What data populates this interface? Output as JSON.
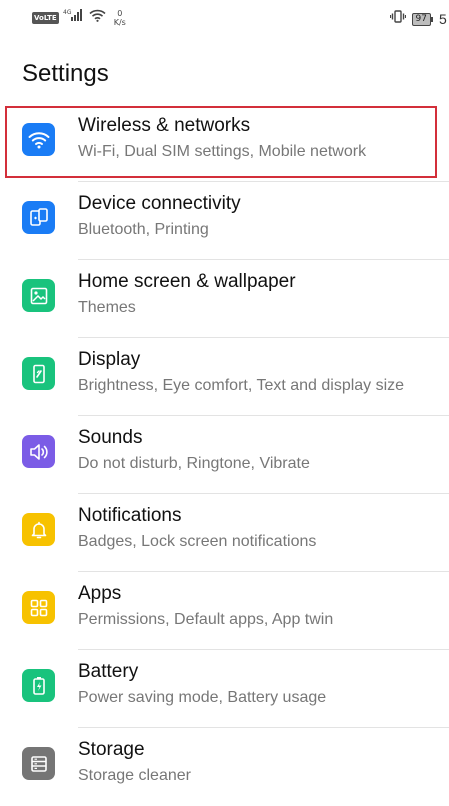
{
  "status_bar": {
    "network_label": "VoLTE",
    "network_type": "4G",
    "speed_value": "0",
    "speed_unit": "K/s",
    "battery": "97",
    "time": "5"
  },
  "page": {
    "title": "Settings"
  },
  "items": [
    {
      "title": "Wireless & networks",
      "subtitle": "Wi-Fi, Dual SIM settings, Mobile network",
      "icon": "wifi-icon",
      "color": "#1a7cf5"
    },
    {
      "title": "Device connectivity",
      "subtitle": "Bluetooth, Printing",
      "icon": "device-connectivity-icon",
      "color": "#1a7cf5"
    },
    {
      "title": "Home screen & wallpaper",
      "subtitle": "Themes",
      "icon": "wallpaper-icon",
      "color": "#19c37d"
    },
    {
      "title": "Display",
      "subtitle": "Brightness, Eye comfort, Text and display size",
      "icon": "display-icon",
      "color": "#19c37d"
    },
    {
      "title": "Sounds",
      "subtitle": "Do not disturb, Ringtone, Vibrate",
      "icon": "sound-icon",
      "color": "#7b5ce6"
    },
    {
      "title": "Notifications",
      "subtitle": "Badges, Lock screen notifications",
      "icon": "bell-icon",
      "color": "#f7c200"
    },
    {
      "title": "Apps",
      "subtitle": "Permissions, Default apps, App twin",
      "icon": "apps-grid-icon",
      "color": "#f7c200"
    },
    {
      "title": "Battery",
      "subtitle": "Power saving mode, Battery usage",
      "icon": "battery-icon",
      "color": "#19c37d"
    },
    {
      "title": "Storage",
      "subtitle": "Storage cleaner",
      "icon": "storage-icon",
      "color": "#757575"
    }
  ],
  "highlight": {
    "target": "Wireless & networks",
    "color": "#d32f3a"
  }
}
